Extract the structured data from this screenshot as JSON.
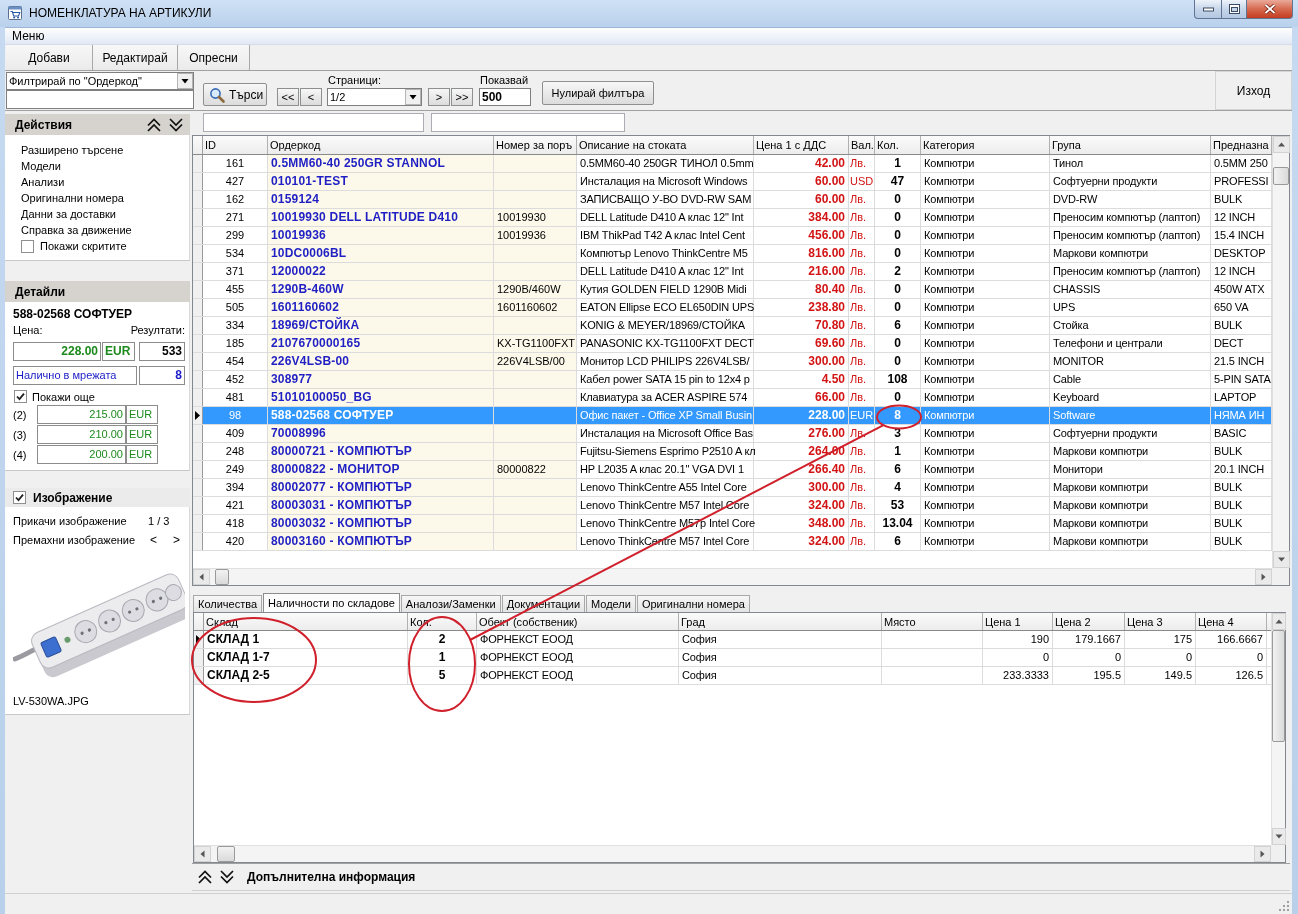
{
  "window": {
    "title": "НОМЕНКЛАТУРА НА АРТИКУЛИ"
  },
  "menu": [
    "Меню"
  ],
  "toolbar": [
    "Добави",
    "Редактирай",
    "Опресни"
  ],
  "filter_bar": {
    "filter_by": "Филтрирай по \"Ордеркод\"",
    "search_button": "Търси",
    "first_page": "<<",
    "previous_page": "<",
    "pages_label": "Страници:",
    "page": "1/2",
    "next_page": ">",
    "last_page": ">>",
    "page_size_label": "Показвай",
    "page_size": "500",
    "reset_button": "Нулирай филтъра",
    "exit_button": "Изход"
  },
  "sidebar": {
    "actions": {
      "title": "Действия",
      "items": [
        "Разширено търсене",
        "Модели",
        "Анализи",
        "Оригинални номера",
        "Данни за доставки",
        "Справка за движение"
      ],
      "show_hidden": {
        "label": "Покажи скритите",
        "checked": false
      }
    },
    "details": {
      "title": "Детайли",
      "item_name": "588-02568 СОФТУЕР",
      "price_label": "Цена:",
      "results_label": "Резултати:",
      "price": "228.00",
      "currency": "EUR",
      "results": "533",
      "network_label": "Налично в мрежата",
      "network_qty": "8",
      "show_more": {
        "label": "Покажи още",
        "checked": true
      },
      "more_prices": [
        {
          "label": "(2)",
          "price": "215.00",
          "currency": "EUR"
        },
        {
          "label": "(3)",
          "price": "210.00",
          "currency": "EUR"
        },
        {
          "label": "(4)",
          "price": "200.00",
          "currency": "EUR"
        }
      ]
    },
    "image": {
      "title": "Изображение",
      "checked": true,
      "attach": "Прикачи изображение",
      "counter": "1 / 3",
      "remove": "Премахни изображение",
      "previous": "<",
      "next": ">",
      "file_name": "LV-530WA.JPG"
    }
  },
  "grid": {
    "columns": [
      {
        "label": "ID",
        "kind": "id"
      },
      {
        "label": "Ордеркод",
        "kind": "code"
      },
      {
        "label": "Номер за поръ",
        "kind": "ref"
      },
      {
        "label": "Описание на стоката",
        "kind": "text"
      },
      {
        "label": "Цена 1 с ДДС",
        "kind": "price"
      },
      {
        "label": "Вал.",
        "kind": "currency"
      },
      {
        "label": "Кол.",
        "kind": "qty"
      },
      {
        "label": "Категория",
        "kind": "text"
      },
      {
        "label": "Група",
        "kind": "text"
      },
      {
        "label": "Предназна",
        "kind": "text"
      }
    ],
    "rows": [
      {
        "cells": [
          "161",
          "0.5MM60-40 250GR STANNOL",
          null,
          "0.5MM60-40 250GR ТИНОЛ 0.5mm",
          "42.00",
          "Лв.",
          "1",
          "Компютри",
          "Тинол",
          "0.5MM 250"
        ],
        "selected": false
      },
      {
        "cells": [
          "427",
          "010101-TEST",
          null,
          "Инсталация на Microsoft Windows",
          "60.00",
          "USD",
          "47",
          "Компютри",
          "Софтуерни продукти",
          "PROFESSI"
        ],
        "selected": false
      },
      {
        "cells": [
          "162",
          "0159124",
          null,
          "ЗАПИСВАЩО У-ВО DVD-RW SAM",
          "60.00",
          "Лв.",
          "0",
          "Компютри",
          "DVD-RW",
          "BULK"
        ],
        "selected": false
      },
      {
        "cells": [
          "271",
          "10019930 DELL LATITUDE D410",
          "10019930",
          "DELL Latitude D410 A клас 12\" Int",
          "384.00",
          "Лв.",
          "0",
          "Компютри",
          "Преносим компютър (лаптоп)",
          "12 INCH"
        ],
        "selected": false
      },
      {
        "cells": [
          "299",
          "10019936",
          "10019936",
          "IBM ThikPad T42 A клас Intel Cent",
          "456.00",
          "Лв.",
          "0",
          "Компютри",
          "Преносим компютър (лаптоп)",
          "15.4 INCH"
        ],
        "selected": false
      },
      {
        "cells": [
          "534",
          "10DC0006BL",
          null,
          "Компютър Lenovo ThinkCentre M5",
          "816.00",
          "Лв.",
          "0",
          "Компютри",
          "Маркови компютри",
          "DESKTOP"
        ],
        "selected": false
      },
      {
        "cells": [
          "371",
          "12000022",
          null,
          "DELL Latitude D410 A клас 12\" Int",
          "216.00",
          "Лв.",
          "2",
          "Компютри",
          "Преносим компютър (лаптоп)",
          "12 INCH"
        ],
        "selected": false
      },
      {
        "cells": [
          "455",
          "1290B-460W",
          "1290B/460W",
          "Кутия GOLDEN FIELD 1290B Midi",
          "80.40",
          "Лв.",
          "0",
          "Компютри",
          "CHASSIS",
          "450W ATX"
        ],
        "selected": false
      },
      {
        "cells": [
          "505",
          "1601160602",
          "1601160602",
          "EATON Ellipse ECO EL650DIN UPS",
          "238.80",
          "Лв.",
          "0",
          "Компютри",
          "UPS",
          "650 VA"
        ],
        "selected": false
      },
      {
        "cells": [
          "334",
          "18969/СТОЙКА",
          null,
          "KONIG & MEYER/18969/СТОЙКА",
          "70.80",
          "Лв.",
          "6",
          "Компютри",
          "Стойка",
          "BULK"
        ],
        "selected": false
      },
      {
        "cells": [
          "185",
          "2107670000165",
          "KX-TG1100FXT",
          "PANASONIC KX-TG1100FXT DECT",
          "69.60",
          "Лв.",
          "0",
          "Компютри",
          "Телефони и централи",
          "DECT"
        ],
        "selected": false
      },
      {
        "cells": [
          "454",
          "226V4LSB-00",
          "226V4LSB/00",
          "Монитор LCD PHILIPS 226V4LSB/",
          "300.00",
          "Лв.",
          "0",
          "Компютри",
          "MONITOR",
          "21.5 INCH"
        ],
        "selected": false
      },
      {
        "cells": [
          "452",
          "308977",
          null,
          "Кабел power SATA 15 pin to 12x4 p",
          "4.50",
          "Лв.",
          "108",
          "Компютри",
          "Cable",
          "5-PIN SATA"
        ],
        "selected": false
      },
      {
        "cells": [
          "481",
          "51010100050_BG",
          null,
          "Клавиатура за ACER ASPIRE 574",
          "66.00",
          "Лв.",
          "0",
          "Компютри",
          "Keyboard",
          "LAPTOP"
        ],
        "selected": false
      },
      {
        "cells": [
          "98",
          "588-02568 СОФТУЕР",
          null,
          "Офис пакет - Office XP Small Busin",
          "228.00",
          "EUR",
          "8",
          "Компютри",
          "Software",
          "НЯМА ИН"
        ],
        "selected": true
      },
      {
        "cells": [
          "409",
          "70008996",
          null,
          "Инсталация на Microsoft Office Bas",
          "276.00",
          "Лв.",
          "3",
          "Компютри",
          "Софтуерни продукти",
          "BASIC"
        ],
        "selected": false
      },
      {
        "cells": [
          "248",
          "80000721 - КОМПЮТЪР",
          null,
          "Fujitsu-Siemens Esprimo P2510 A кл",
          "264.00",
          "Лв.",
          "1",
          "Компютри",
          "Маркови компютри",
          "BULK"
        ],
        "selected": false
      },
      {
        "cells": [
          "249",
          "80000822 - МОНИТОР",
          "80000822",
          "HP L2035 A клас 20.1\" VGA DVI 1",
          "266.40",
          "Лв.",
          "6",
          "Компютри",
          "Монитори",
          "20.1 INCH"
        ],
        "selected": false
      },
      {
        "cells": [
          "394",
          "80002077 - КОМПЮТЪР",
          null,
          "Lenovo ThinkCentre A55 Intel Core",
          "300.00",
          "Лв.",
          "4",
          "Компютри",
          "Маркови компютри",
          "BULK"
        ],
        "selected": false
      },
      {
        "cells": [
          "421",
          "80003031 - КОМПЮТЪР",
          null,
          "Lenovo ThinkCentre M57 Intel Core",
          "324.00",
          "Лв.",
          "53",
          "Компютри",
          "Маркови компютри",
          "BULK"
        ],
        "selected": false
      },
      {
        "cells": [
          "418",
          "80003032 - КОМПЮТЪР",
          null,
          "Lenovo ThinkCentre M57p Intel Core",
          "348.00",
          "Лв.",
          "13.04",
          "Компютри",
          "Маркови компютри",
          "BULK"
        ],
        "selected": false
      },
      {
        "cells": [
          "420",
          "80003160 - КОМПЮТЪР",
          null,
          "Lenovo ThinkCentre M57 Intel Core",
          "324.00",
          "Лв.",
          "6",
          "Компютри",
          "Маркови компютри",
          "BULK"
        ],
        "selected": false
      }
    ]
  },
  "detail_tabs": [
    {
      "label": "Количества",
      "selected": false
    },
    {
      "label": "Наличности по складове",
      "selected": true
    },
    {
      "label": "Аналози/Заменки",
      "selected": false
    },
    {
      "label": "Документации",
      "selected": false
    },
    {
      "label": "Модели",
      "selected": false
    },
    {
      "label": "Оригинални номера",
      "selected": false
    }
  ],
  "stock_grid": {
    "columns": [
      {
        "label": "Склад",
        "kind": "name"
      },
      {
        "label": "Кол.",
        "kind": "qty"
      },
      {
        "label": "Обект (собственик)",
        "kind": "text"
      },
      {
        "label": "Град",
        "kind": "text"
      },
      {
        "label": "Място",
        "kind": "text"
      },
      {
        "label": "Цена 1",
        "kind": "number"
      },
      {
        "label": "Цена 2",
        "kind": "number"
      },
      {
        "label": "Цена 3",
        "kind": "number"
      },
      {
        "label": "Цена 4",
        "kind": "number"
      }
    ],
    "rows": [
      {
        "cells": [
          "СКЛАД 1",
          "2",
          "ФОРНЕКСТ ЕООД",
          "София",
          null,
          "190",
          "179.1667",
          "175",
          "166.6667"
        ],
        "current": true
      },
      {
        "cells": [
          "СКЛАД 1-7",
          "1",
          "ФОРНЕКСТ ЕООД",
          "София",
          null,
          "0",
          "0",
          "0",
          "0"
        ],
        "current": false
      },
      {
        "cells": [
          "СКЛАД 2-5",
          "5",
          "ФОРНЕКСТ ЕООД",
          "София",
          null,
          "233.3333",
          "195.5",
          "149.5",
          "126.5"
        ],
        "current": false
      }
    ]
  },
  "extra_info": {
    "title": "Допълнителна информация"
  }
}
